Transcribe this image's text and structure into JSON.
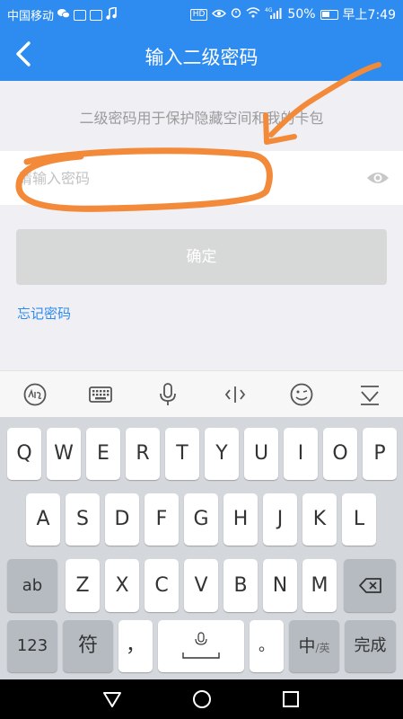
{
  "status_bar": {
    "carrier": "中国移动",
    "battery_percent": "50%",
    "network": "4G",
    "time": "早上7:49",
    "hd_label": "HD"
  },
  "header": {
    "title": "输入二级密码",
    "back_icon": "chevron-left-icon"
  },
  "hint_text": "二级密码用于保护隐藏空间和我的卡包",
  "password_field": {
    "value": "",
    "placeholder": "请输入密码"
  },
  "confirm_label": "确定",
  "forgot_label": "忘记密码",
  "keyboard": {
    "toolbar": [
      "handwriting-icon",
      "keyboard-icon",
      "microphone-icon",
      "cursor-icon",
      "emoji-icon",
      "collapse-keyboard-icon"
    ],
    "row1": [
      "Q",
      "W",
      "E",
      "R",
      "T",
      "Y",
      "U",
      "I",
      "O",
      "P"
    ],
    "row2": [
      "A",
      "S",
      "D",
      "F",
      "G",
      "H",
      "J",
      "K",
      "L"
    ],
    "row3": [
      "Z",
      "X",
      "C",
      "V",
      "B",
      "N",
      "M"
    ],
    "ab_key": "ab",
    "num_key": "123",
    "symbol_key": "符",
    "comma_key": "，",
    "period_key": "。",
    "lang_key_main": "中",
    "lang_key_sub": "/英",
    "done_key": "完成"
  },
  "colors": {
    "brand_blue": "#2e8cf0",
    "annotation_orange": "#f28a3a",
    "button_disabled": "#d7d8d8"
  }
}
